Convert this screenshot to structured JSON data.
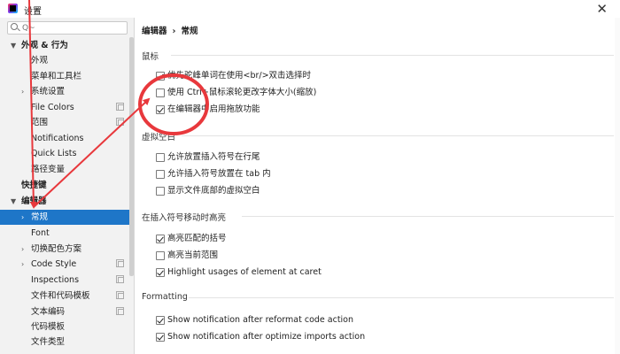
{
  "window": {
    "title": "设置",
    "close_glyph": "✕"
  },
  "sidebar": {
    "search": {
      "value": "",
      "placeholder": "Q~"
    },
    "items": [
      {
        "label": "外观 & 行为",
        "expanded": true,
        "bold": true
      },
      {
        "label": "外观"
      },
      {
        "label": "菜单和工具栏"
      },
      {
        "label": "系统设置",
        "collapsed": true
      },
      {
        "label": "File Colors"
      },
      {
        "label": "范围"
      },
      {
        "label": "Notifications"
      },
      {
        "label": "Quick Lists"
      },
      {
        "label": "路径变量"
      },
      {
        "label": "快捷键",
        "bold": true
      },
      {
        "label": "编辑器",
        "expanded": true,
        "bold": true
      },
      {
        "label": "常规",
        "collapsed": true,
        "selected": true
      },
      {
        "label": "Font"
      },
      {
        "label": "切换配色方案",
        "collapsed": true
      },
      {
        "label": "Code Style",
        "collapsed": true
      },
      {
        "label": "Inspections"
      },
      {
        "label": "文件和代码模板"
      },
      {
        "label": "文本编码"
      },
      {
        "label": "代码模板"
      },
      {
        "label": "文件类型"
      }
    ]
  },
  "main": {
    "breadcrumb": [
      "编辑器",
      "常规"
    ],
    "breadcrumb_sep": "›",
    "sections": [
      {
        "title": "鼠标",
        "options": [
          {
            "label": "优先驼峰单词在使用<br/>双击选择时",
            "checked": true
          },
          {
            "label": "使用 Ctrl+鼠标滚轮更改字体大小(缩放)",
            "checked": false
          },
          {
            "label": "在编辑器中启用拖放功能",
            "checked": true
          }
        ]
      },
      {
        "title": "虚拟空白",
        "options": [
          {
            "label": "允许放置插入符号在行尾",
            "checked": false
          },
          {
            "label": "允许插入符号放置在 tab 内",
            "checked": false
          },
          {
            "label": "显示文件底部的虚拟空白",
            "checked": false
          }
        ]
      },
      {
        "title": "在插入符号移动时高亮",
        "options": [
          {
            "label": "高亮匹配的括号",
            "checked": true
          },
          {
            "label": "高亮当前范围",
            "checked": false
          },
          {
            "label": "Highlight usages of element at caret",
            "checked": true
          }
        ]
      },
      {
        "title": "Formatting",
        "options": [
          {
            "label": "Show notification after reformat code action",
            "checked": true
          },
          {
            "label": "Show notification after optimize imports action",
            "checked": true
          }
        ]
      }
    ]
  },
  "colors": {
    "accent": "#1e76c8",
    "annotation": "#e8383c"
  },
  "icons": [
    "app-logo-icon",
    "close-icon",
    "search-icon",
    "expand-arrow-icon",
    "collapse-arrow-icon",
    "copy-scope-icon",
    "checkbox-icon"
  ]
}
